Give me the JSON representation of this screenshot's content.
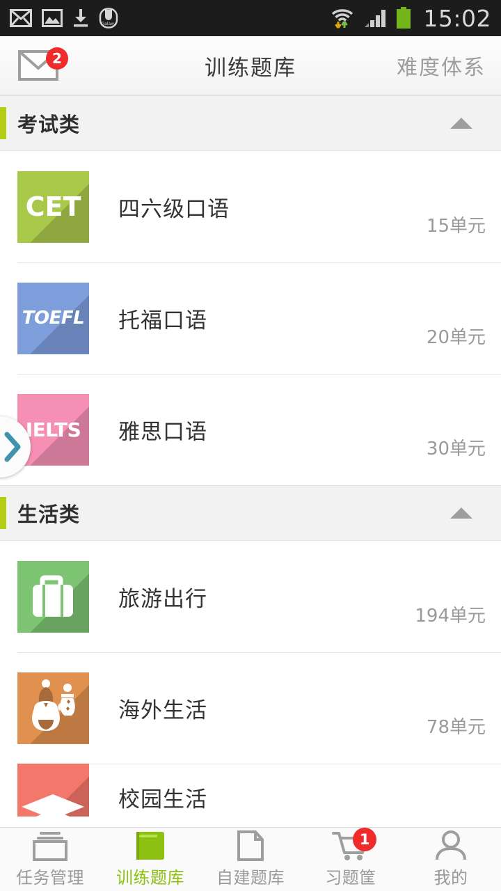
{
  "status_bar": {
    "time": "15:02",
    "left_icons": [
      "mail-icon",
      "gallery-icon",
      "download-icon",
      "galaxy-icon"
    ],
    "right_icons": [
      "wifi-icon",
      "signal-icon",
      "battery-icon"
    ],
    "background": "#1c1c1c"
  },
  "header": {
    "mail_icon": "mail-icon",
    "mail_badge": "2",
    "title": "训练题库",
    "action_label": "难度体系",
    "badge_color": "#ef2b2b"
  },
  "accent_color": "#b5cc14",
  "sections": [
    {
      "title": "考试类",
      "collapse_icon": "chevron-up-icon",
      "items": [
        {
          "icon_text": "CET",
          "icon_kind": "cet",
          "color": "#a8c84a",
          "title": "四六级口语",
          "count": "15单元"
        },
        {
          "icon_text": "TOEFL",
          "icon_kind": "toefl",
          "color": "#7d9ddb",
          "title": "托福口语",
          "count": "20单元"
        },
        {
          "icon_text": "IELTS",
          "icon_kind": "ielts",
          "color": "#f590b4",
          "title": "雅思口语",
          "count": "30单元"
        }
      ]
    },
    {
      "title": "生活类",
      "collapse_icon": "chevron-up-icon",
      "items": [
        {
          "icon_text": "",
          "icon_kind": "suitcase",
          "color": "#7dc473",
          "title": "旅游出行",
          "count": "194单元"
        },
        {
          "icon_text": "",
          "icon_kind": "winter",
          "color": "#e0914f",
          "title": "海外生活",
          "count": "78单元"
        },
        {
          "icon_text": "",
          "icon_kind": "campus",
          "color": "#f4776b",
          "title": "校园生活",
          "count": ""
        }
      ]
    }
  ],
  "drawer_handle": {
    "icon": "chevron-right-icon",
    "color": "#3f93ad"
  },
  "bottom_nav": {
    "active_color": "#8cc011",
    "items": [
      {
        "label": "任务管理",
        "icon": "tasks-icon",
        "badge": "",
        "active": false
      },
      {
        "label": "训练题库",
        "icon": "book-icon",
        "badge": "",
        "active": true
      },
      {
        "label": "自建题库",
        "icon": "document-icon",
        "badge": "",
        "active": false
      },
      {
        "label": "习题筐",
        "icon": "cart-icon",
        "badge": "1",
        "active": false
      },
      {
        "label": "我的",
        "icon": "person-icon",
        "badge": "",
        "active": false
      }
    ]
  }
}
